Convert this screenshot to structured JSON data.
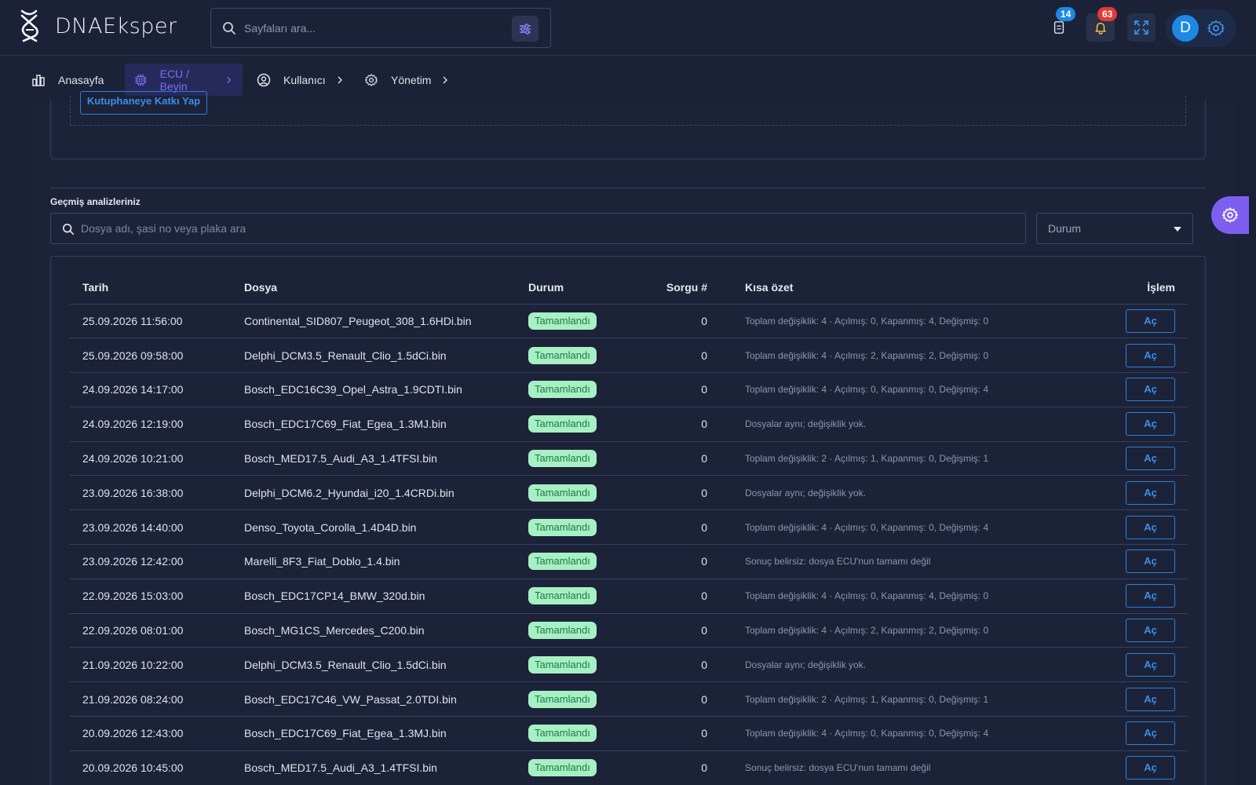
{
  "header": {
    "logo_text": "DNAEksper",
    "search_placeholder": "Sayfaları ara...",
    "doc_badge": "14",
    "notification_badge": "63",
    "avatar_initial": "D",
    "accent_color": "#7e6cf0"
  },
  "nav": {
    "items": [
      {
        "label": "Anasayfa",
        "icon": "bar-chart-icon"
      },
      {
        "label": "ECU / Beyin",
        "icon": "chip-icon"
      },
      {
        "label": "Kullanıcı",
        "icon": "user-circle-icon"
      },
      {
        "label": "Yönetim",
        "icon": "gear-icon"
      }
    ]
  },
  "upper": {
    "contribute_button": "Kutuphaneye Katkı Yap"
  },
  "history": {
    "title": "Geçmiş analizleriniz",
    "search_placeholder": "Dosya adı, şasi no veya plaka ara",
    "status_select": "Durum",
    "columns": {
      "date": "Tarih",
      "file": "Dosya",
      "status": "Durum",
      "count": "Sorgu #",
      "summary": "Kısa özet",
      "action": "İşlem"
    },
    "rows": [
      {
        "date": "25.09.2026 11:56:00",
        "file": "Continental_SID807_Peugeot_308_1.6HDi.bin",
        "status": "Tamamlandı",
        "count": "0",
        "summary": "Toplam değişiklik: 4 · Açılmış: 0, Kapanmış: 4, Değişmiş: 0",
        "action": "Aç"
      },
      {
        "date": "25.09.2026 09:58:00",
        "file": "Delphi_DCM3.5_Renault_Clio_1.5dCi.bin",
        "status": "Tamamlandı",
        "count": "0",
        "summary": "Toplam değişiklik: 4 · Açılmış: 2, Kapanmış: 2, Değişmiş: 0",
        "action": "Aç"
      },
      {
        "date": "24.09.2026 14:17:00",
        "file": "Bosch_EDC16C39_Opel_Astra_1.9CDTI.bin",
        "status": "Tamamlandı",
        "count": "0",
        "summary": "Toplam değişiklik: 4 · Açılmış: 0, Kapanmış: 0, Değişmiş: 4",
        "action": "Aç"
      },
      {
        "date": "24.09.2026 12:19:00",
        "file": "Bosch_EDC17C69_Fiat_Egea_1.3MJ.bin",
        "status": "Tamamlandı",
        "count": "0",
        "summary": "Dosyalar aynı; değişiklik yok.",
        "action": "Aç"
      },
      {
        "date": "24.09.2026 10:21:00",
        "file": "Bosch_MED17.5_Audi_A3_1.4TFSI.bin",
        "status": "Tamamlandı",
        "count": "0",
        "summary": "Toplam değişiklik: 2 · Açılmış: 1, Kapanmış: 0, Değişmiş: 1",
        "action": "Aç"
      },
      {
        "date": "23.09.2026 16:38:00",
        "file": "Delphi_DCM6.2_Hyundai_i20_1.4CRDi.bin",
        "status": "Tamamlandı",
        "count": "0",
        "summary": "Dosyalar aynı; değişiklik yok.",
        "action": "Aç"
      },
      {
        "date": "23.09.2026 14:40:00",
        "file": "Denso_Toyota_Corolla_1.4D4D.bin",
        "status": "Tamamlandı",
        "count": "0",
        "summary": "Toplam değişiklik: 4 · Açılmış: 0, Kapanmış: 0, Değişmiş: 4",
        "action": "Aç"
      },
      {
        "date": "23.09.2026 12:42:00",
        "file": "Marelli_8F3_Fiat_Doblo_1.4.bin",
        "status": "Tamamlandı",
        "count": "0",
        "summary": "Sonuç belirsiz: dosya ECU'nun tamamı değil",
        "action": "Aç"
      },
      {
        "date": "22.09.2026 15:03:00",
        "file": "Bosch_EDC17CP14_BMW_320d.bin",
        "status": "Tamamlandı",
        "count": "0",
        "summary": "Toplam değişiklik: 4 · Açılmış: 0, Kapanmış: 4, Değişmiş: 0",
        "action": "Aç"
      },
      {
        "date": "22.09.2026 08:01:00",
        "file": "Bosch_MG1CS_Mercedes_C200.bin",
        "status": "Tamamlandı",
        "count": "0",
        "summary": "Toplam değişiklik: 4 · Açılmış: 2, Kapanmış: 2, Değişmiş: 0",
        "action": "Aç"
      },
      {
        "date": "21.09.2026 10:22:00",
        "file": "Delphi_DCM3.5_Renault_Clio_1.5dCi.bin",
        "status": "Tamamlandı",
        "count": "0",
        "summary": "Dosyalar aynı; değişiklik yok.",
        "action": "Aç"
      },
      {
        "date": "21.09.2026 08:24:00",
        "file": "Bosch_EDC17C46_VW_Passat_2.0TDI.bin",
        "status": "Tamamlandı",
        "count": "0",
        "summary": "Toplam değişiklik: 2 · Açılmış: 1, Kapanmış: 0, Değişmiş: 1",
        "action": "Aç"
      },
      {
        "date": "20.09.2026 12:43:00",
        "file": "Bosch_EDC17C69_Fiat_Egea_1.3MJ.bin",
        "status": "Tamamlandı",
        "count": "0",
        "summary": "Toplam değişiklik: 4 · Açılmış: 0, Kapanmış: 0, Değişmiş: 4",
        "action": "Aç"
      },
      {
        "date": "20.09.2026 10:45:00",
        "file": "Bosch_MED17.5_Audi_A3_1.4TFSI.bin",
        "status": "Tamamlandı",
        "count": "0",
        "summary": "Sonuç belirsiz: dosya ECU'nun tamamı değil",
        "action": "Aç"
      }
    ]
  }
}
